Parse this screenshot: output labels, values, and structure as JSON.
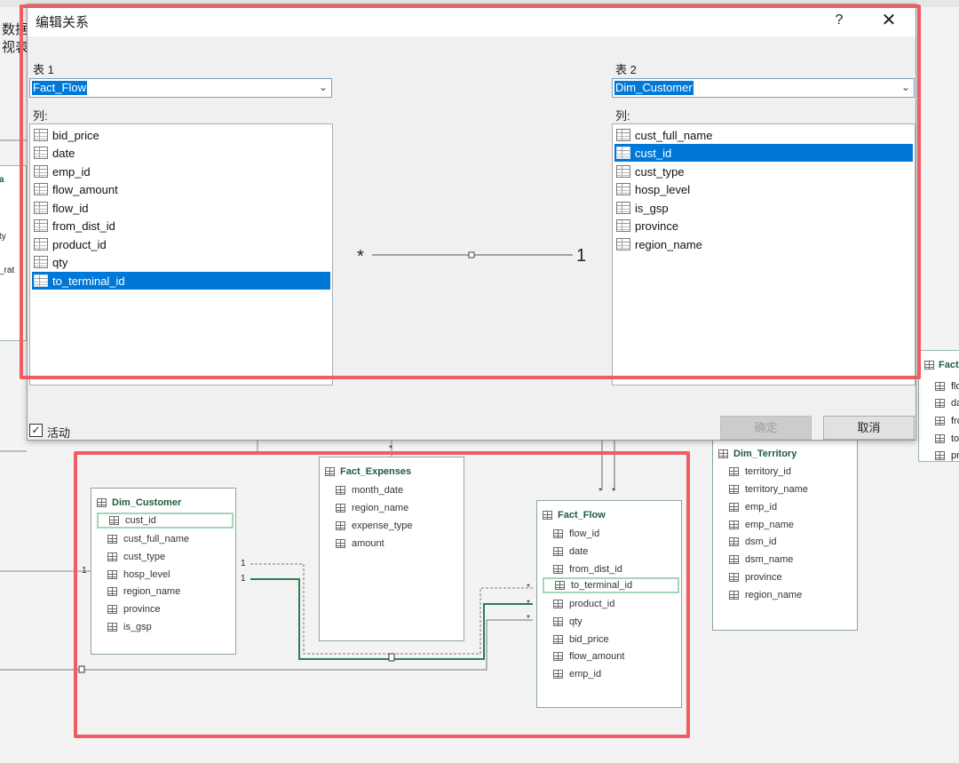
{
  "background": {
    "left_label_1": "数据",
    "left_label_2": "视表",
    "frag_left_lines": [
      "a",
      "ty",
      "_rat"
    ],
    "frag_right_title": "Fact_",
    "frag_right_lines": [
      "flo",
      "da",
      "fro",
      "to",
      "pr"
    ],
    "rel_ones": [
      "1",
      "1",
      "1"
    ],
    "rel_stars": [
      "*",
      "*",
      "*",
      "*",
      "*",
      "*"
    ],
    "tables": {
      "dim_customer": {
        "title": "Dim_Customer",
        "fields": [
          "cust_id",
          "cust_full_name",
          "cust_type",
          "hosp_level",
          "region_name",
          "province",
          "is_gsp"
        ]
      },
      "fact_expenses": {
        "title": "Fact_Expenses",
        "fields": [
          "month_date",
          "region_name",
          "expense_type",
          "amount"
        ]
      },
      "fact_flow": {
        "title": "Fact_Flow",
        "fields": [
          "flow_id",
          "date",
          "from_dist_id",
          "to_terminal_id",
          "product_id",
          "qty",
          "bid_price",
          "flow_amount",
          "emp_id"
        ]
      },
      "dim_territory": {
        "title": "Dim_Territory",
        "fields": [
          "territory_id",
          "territory_name",
          "emp_id",
          "emp_name",
          "dsm_id",
          "dsm_name",
          "province",
          "region_name"
        ]
      }
    }
  },
  "dialog": {
    "title": "编辑关系",
    "help": "?",
    "close": "✕",
    "table1_label": "表 1",
    "table1_value": "Fact_Flow",
    "table2_label": "表 2",
    "table2_value": "Dim_Customer",
    "columns_label_1": "列:",
    "columns_label_2": "列:",
    "columns1": [
      "bid_price",
      "date",
      "emp_id",
      "flow_amount",
      "flow_id",
      "from_dist_id",
      "product_id",
      "qty",
      "to_terminal_id"
    ],
    "columns1_selected": "to_terminal_id",
    "columns2": [
      "cust_full_name",
      "cust_id",
      "cust_type",
      "hosp_level",
      "is_gsp",
      "province",
      "region_name"
    ],
    "columns2_selected": "cust_id",
    "cardinality_left": "*",
    "cardinality_right": "1",
    "active_label": "活动",
    "active_checked": true,
    "ok_label": "确定",
    "cancel_label": "取消"
  },
  "colors": {
    "selection": "#0078d7",
    "highlight_frame": "#ef5d63",
    "relation_line": "#2e7d4f"
  }
}
